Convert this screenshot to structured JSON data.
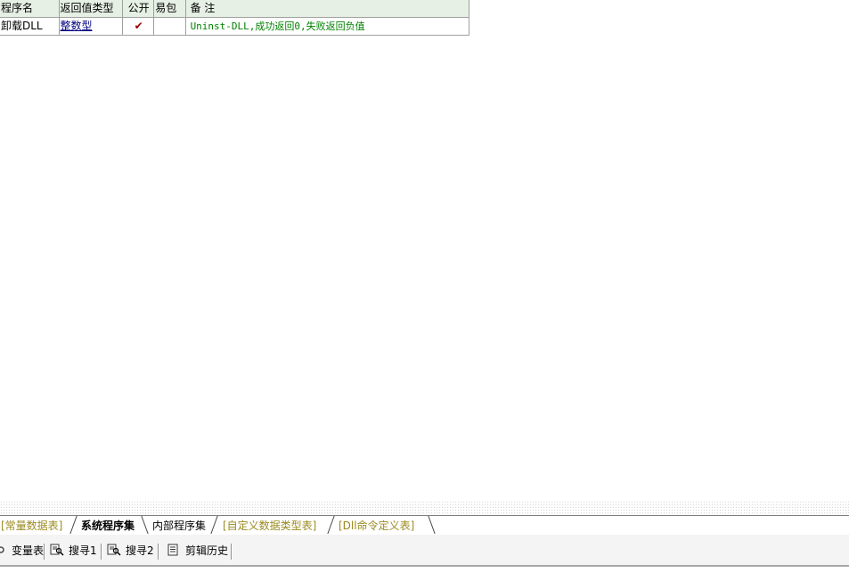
{
  "table": {
    "headers": {
      "name": "程序名",
      "return_type": "返回值类型",
      "public": "公开",
      "easy_pack": "易包",
      "note": "备 注"
    },
    "rows": [
      {
        "name": "卸载DLL",
        "return_type": "整数型",
        "public": "✔",
        "easy_pack": "",
        "note": "Uninst-DLL,成功返回0,失败返回负值"
      }
    ]
  },
  "tabs": {
    "constants": "[常量数据表]",
    "system_programs": "系统程序集",
    "internal_programs": "内部程序集",
    "custom_types": "[自定义数据类型表]",
    "dll_commands": "[Dll命令定义表]"
  },
  "toolbar": {
    "variables": "变量表",
    "search1": "搜寻1",
    "search2": "搜寻2",
    "clip_history": "剪辑历史"
  },
  "colors": {
    "header_bg": "#e6f0e4",
    "note_text": "#008000",
    "return_type": "#000080",
    "inactive_tab": "#9b8a20"
  }
}
